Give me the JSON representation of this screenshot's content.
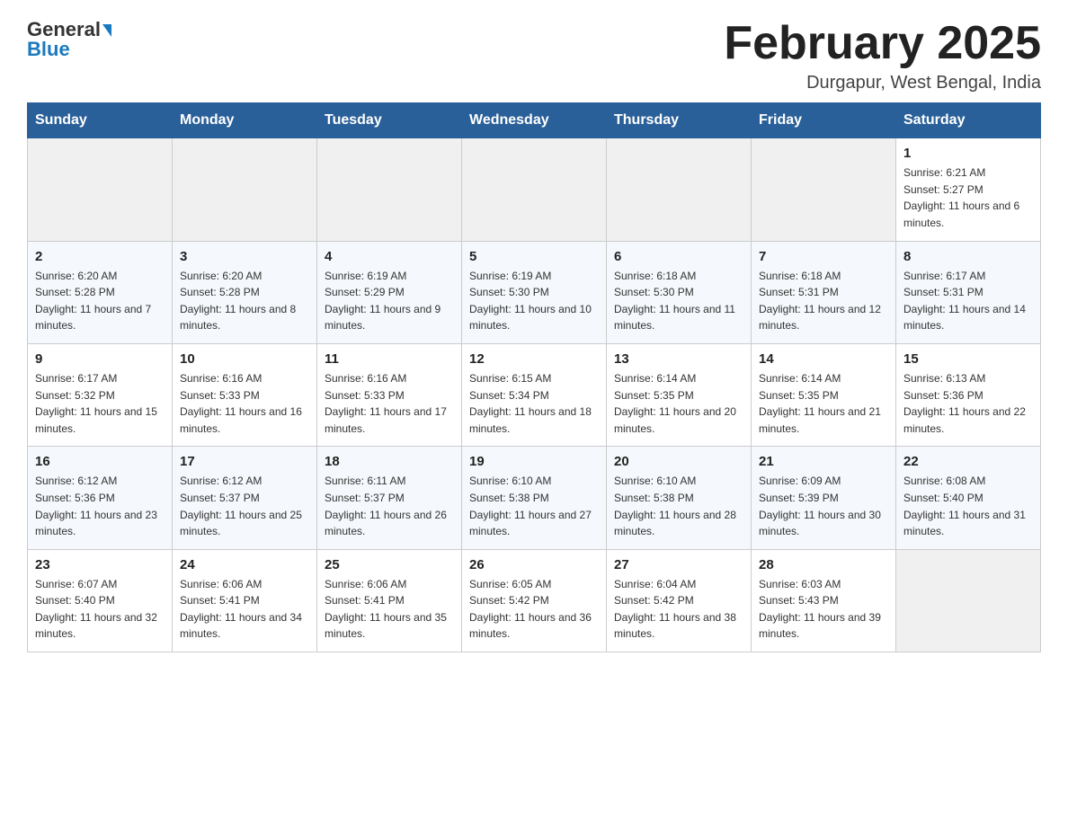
{
  "header": {
    "logo_general": "General",
    "logo_blue": "Blue",
    "title": "February 2025",
    "location": "Durgapur, West Bengal, India"
  },
  "weekdays": [
    "Sunday",
    "Monday",
    "Tuesday",
    "Wednesday",
    "Thursday",
    "Friday",
    "Saturday"
  ],
  "weeks": [
    [
      {
        "day": "",
        "info": ""
      },
      {
        "day": "",
        "info": ""
      },
      {
        "day": "",
        "info": ""
      },
      {
        "day": "",
        "info": ""
      },
      {
        "day": "",
        "info": ""
      },
      {
        "day": "",
        "info": ""
      },
      {
        "day": "1",
        "info": "Sunrise: 6:21 AM\nSunset: 5:27 PM\nDaylight: 11 hours and 6 minutes."
      }
    ],
    [
      {
        "day": "2",
        "info": "Sunrise: 6:20 AM\nSunset: 5:28 PM\nDaylight: 11 hours and 7 minutes."
      },
      {
        "day": "3",
        "info": "Sunrise: 6:20 AM\nSunset: 5:28 PM\nDaylight: 11 hours and 8 minutes."
      },
      {
        "day": "4",
        "info": "Sunrise: 6:19 AM\nSunset: 5:29 PM\nDaylight: 11 hours and 9 minutes."
      },
      {
        "day": "5",
        "info": "Sunrise: 6:19 AM\nSunset: 5:30 PM\nDaylight: 11 hours and 10 minutes."
      },
      {
        "day": "6",
        "info": "Sunrise: 6:18 AM\nSunset: 5:30 PM\nDaylight: 11 hours and 11 minutes."
      },
      {
        "day": "7",
        "info": "Sunrise: 6:18 AM\nSunset: 5:31 PM\nDaylight: 11 hours and 12 minutes."
      },
      {
        "day": "8",
        "info": "Sunrise: 6:17 AM\nSunset: 5:31 PM\nDaylight: 11 hours and 14 minutes."
      }
    ],
    [
      {
        "day": "9",
        "info": "Sunrise: 6:17 AM\nSunset: 5:32 PM\nDaylight: 11 hours and 15 minutes."
      },
      {
        "day": "10",
        "info": "Sunrise: 6:16 AM\nSunset: 5:33 PM\nDaylight: 11 hours and 16 minutes."
      },
      {
        "day": "11",
        "info": "Sunrise: 6:16 AM\nSunset: 5:33 PM\nDaylight: 11 hours and 17 minutes."
      },
      {
        "day": "12",
        "info": "Sunrise: 6:15 AM\nSunset: 5:34 PM\nDaylight: 11 hours and 18 minutes."
      },
      {
        "day": "13",
        "info": "Sunrise: 6:14 AM\nSunset: 5:35 PM\nDaylight: 11 hours and 20 minutes."
      },
      {
        "day": "14",
        "info": "Sunrise: 6:14 AM\nSunset: 5:35 PM\nDaylight: 11 hours and 21 minutes."
      },
      {
        "day": "15",
        "info": "Sunrise: 6:13 AM\nSunset: 5:36 PM\nDaylight: 11 hours and 22 minutes."
      }
    ],
    [
      {
        "day": "16",
        "info": "Sunrise: 6:12 AM\nSunset: 5:36 PM\nDaylight: 11 hours and 23 minutes."
      },
      {
        "day": "17",
        "info": "Sunrise: 6:12 AM\nSunset: 5:37 PM\nDaylight: 11 hours and 25 minutes."
      },
      {
        "day": "18",
        "info": "Sunrise: 6:11 AM\nSunset: 5:37 PM\nDaylight: 11 hours and 26 minutes."
      },
      {
        "day": "19",
        "info": "Sunrise: 6:10 AM\nSunset: 5:38 PM\nDaylight: 11 hours and 27 minutes."
      },
      {
        "day": "20",
        "info": "Sunrise: 6:10 AM\nSunset: 5:38 PM\nDaylight: 11 hours and 28 minutes."
      },
      {
        "day": "21",
        "info": "Sunrise: 6:09 AM\nSunset: 5:39 PM\nDaylight: 11 hours and 30 minutes."
      },
      {
        "day": "22",
        "info": "Sunrise: 6:08 AM\nSunset: 5:40 PM\nDaylight: 11 hours and 31 minutes."
      }
    ],
    [
      {
        "day": "23",
        "info": "Sunrise: 6:07 AM\nSunset: 5:40 PM\nDaylight: 11 hours and 32 minutes."
      },
      {
        "day": "24",
        "info": "Sunrise: 6:06 AM\nSunset: 5:41 PM\nDaylight: 11 hours and 34 minutes."
      },
      {
        "day": "25",
        "info": "Sunrise: 6:06 AM\nSunset: 5:41 PM\nDaylight: 11 hours and 35 minutes."
      },
      {
        "day": "26",
        "info": "Sunrise: 6:05 AM\nSunset: 5:42 PM\nDaylight: 11 hours and 36 minutes."
      },
      {
        "day": "27",
        "info": "Sunrise: 6:04 AM\nSunset: 5:42 PM\nDaylight: 11 hours and 38 minutes."
      },
      {
        "day": "28",
        "info": "Sunrise: 6:03 AM\nSunset: 5:43 PM\nDaylight: 11 hours and 39 minutes."
      },
      {
        "day": "",
        "info": ""
      }
    ]
  ]
}
